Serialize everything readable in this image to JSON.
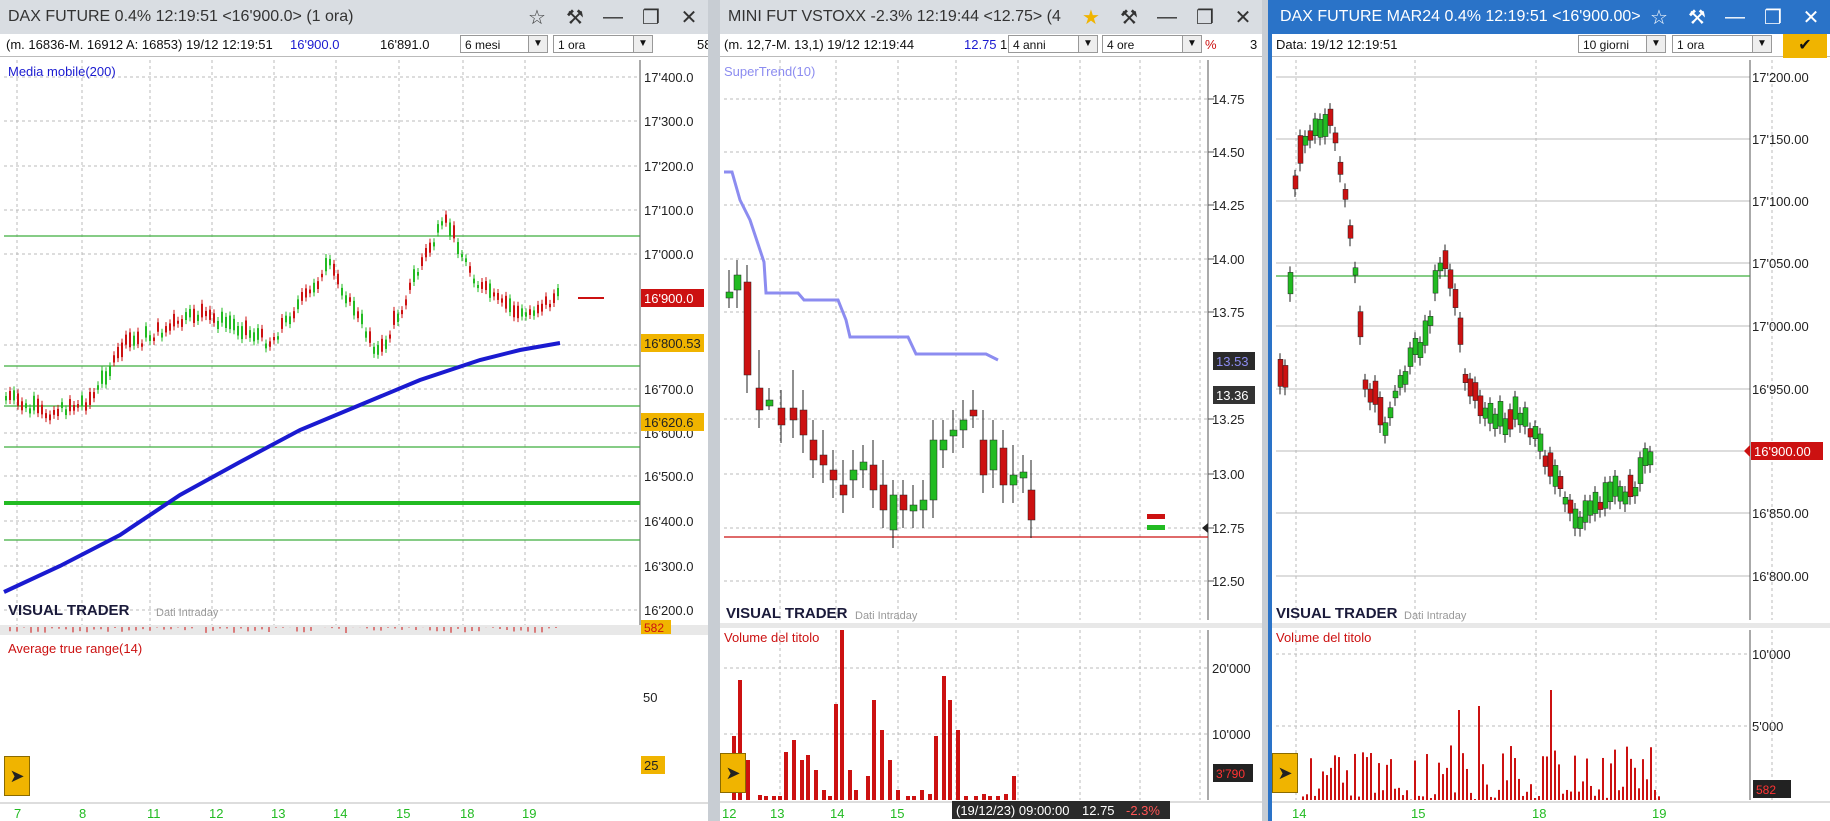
{
  "panels": [
    {
      "title": "DAX FUTURE 0.4% 12:19:51  <16'900.0> (1 ora)",
      "info": "(m. 16836-M. 16912 A: 16853)  19/12 12:19:51",
      "price_blue": "16'900.0",
      "price_black": "16'891.0",
      "period_select": "6 mesi",
      "interval_select": "1 ora",
      "toolbar_tail": "58",
      "indicator_label": "Media mobile(200)",
      "sub_indicator_label": "Average true range(14)",
      "brand": "VISUAL TRADER",
      "brand_sub": "Dati Intraday",
      "y_ticks": [
        "17'400.0",
        "17'300.0",
        "17'200.0",
        "17'100.0",
        "17'000.0",
        "16'800.0",
        "16'700.0",
        "16'600.0",
        "16'500.0",
        "16'400.0",
        "16'300.0",
        "16'200.0"
      ],
      "price_badges": {
        "last": "16'900.0",
        "ma": "16'800.53",
        "low": "16'620.6",
        "vol": "582"
      },
      "sub_ticks": [
        "50"
      ],
      "sub_badge": "25",
      "x_ticks": [
        "7",
        "8",
        "11",
        "12",
        "13",
        "14",
        "15",
        "18",
        "19"
      ]
    },
    {
      "title": "MINI FUT VSTOXX -2.3% 12:19:44  <12.75> (4",
      "info": "(m. 12,7-M. 13,1)  19/12 12:19:44",
      "price_blue": "12.75",
      "toolbar_tail": "1",
      "period_select": "4 anni",
      "interval_select": "4 ore",
      "pct_mark": "%",
      "toolbar_tail2": "3",
      "indicator_label": "SuperTrend(10)",
      "sub_indicator_label": "Volume del titolo",
      "brand": "VISUAL TRADER",
      "brand_sub": "Dati Intraday",
      "y_ticks": [
        "14.75",
        "14.50",
        "14.25",
        "14.00",
        "13.75",
        "13.25",
        "13.00",
        "12.75",
        "12.50"
      ],
      "price_badges": {
        "st": "13.53",
        "cur": "13.36"
      },
      "sub_ticks": [
        "20'000",
        "10'000"
      ],
      "sub_badge": "3'790",
      "tooltip": {
        "date": "(19/12/23) 09:00:00",
        "price": "12.75",
        "change": "-2.3%"
      },
      "x_ticks": [
        "12",
        "13",
        "14",
        "15"
      ]
    },
    {
      "title": "DAX FUTURE MAR24 0.4% 12:19:51  <16'900.00>",
      "info": "Data: 19/12 12:19:51",
      "period_select": "10 giorni",
      "interval_select": "1 ora",
      "sub_indicator_label": "Volume del titolo",
      "brand": "VISUAL TRADER",
      "brand_sub": "Dati Intraday",
      "y_ticks": [
        "17'200.00",
        "17'150.00",
        "17'100.00",
        "17'050.00",
        "17'000.00",
        "16'950.00",
        "16'850.00",
        "16'800.00"
      ],
      "price_badges": {
        "last": "16'900.00"
      },
      "sub_ticks": [
        "10'000",
        "5'000"
      ],
      "sub_badge": "582",
      "x_ticks": [
        "14",
        "15",
        "18",
        "19"
      ]
    }
  ],
  "colors": {
    "active_title": "#2a73c8",
    "inactive_title": "#d9dde2",
    "up": "#22bb22",
    "down": "#cc1111",
    "ma": "#1a1ad0",
    "st": "#8c8cf0",
    "badge_red": "#cc1111",
    "badge_orange": "#f0b400"
  },
  "icons": [
    "star-icon",
    "hammer-icon",
    "minimize-icon",
    "maximize-icon",
    "close-icon",
    "arrow-right-icon",
    "chevron-down-icon"
  ]
}
